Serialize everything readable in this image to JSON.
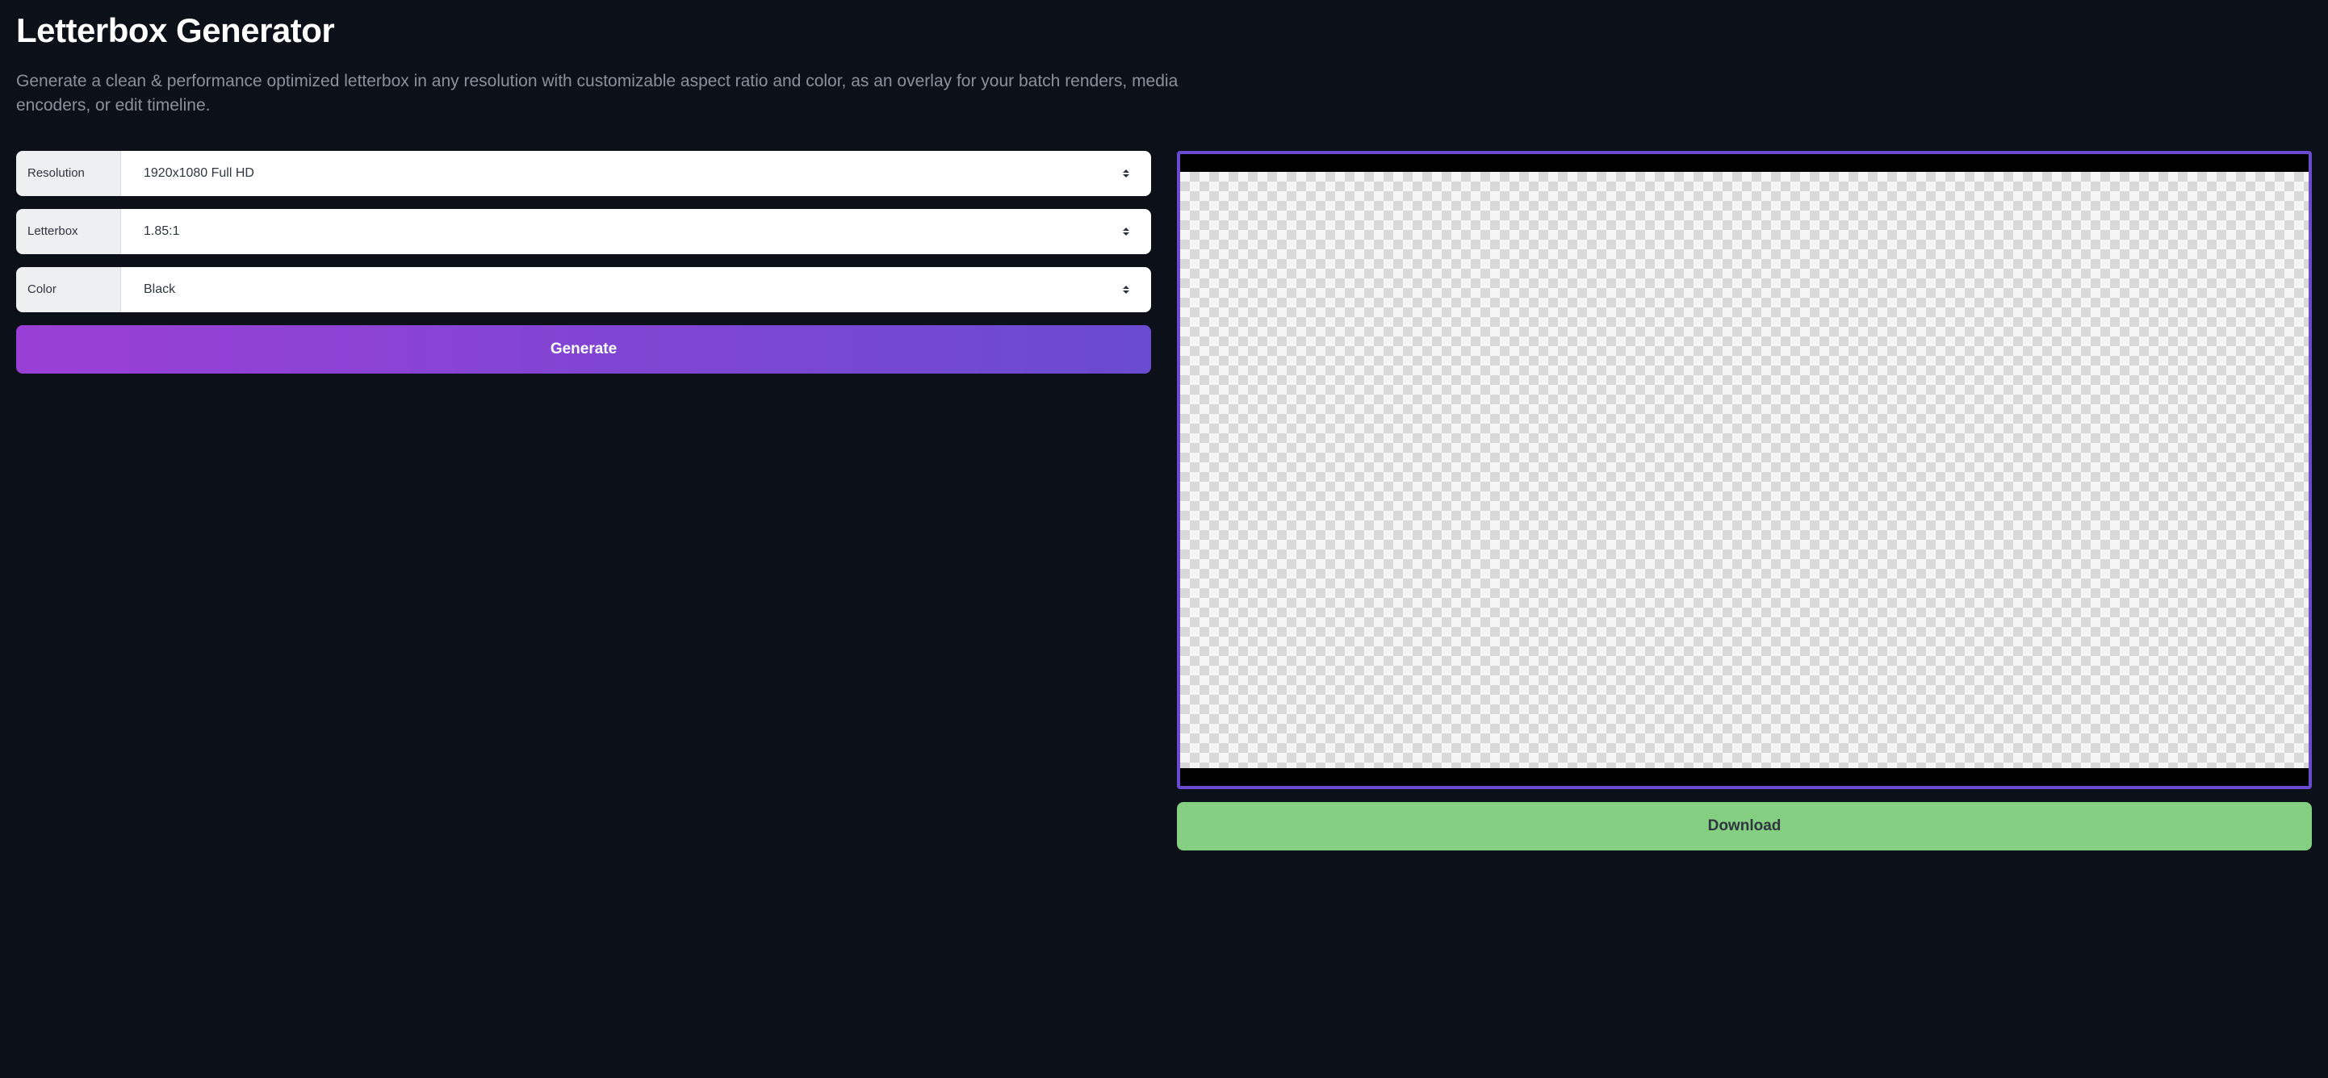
{
  "header": {
    "title": "Letterbox Generator",
    "subtitle": "Generate a clean & performance optimized letterbox in any resolution with customizable aspect ratio and color, as an overlay for your batch renders, media encoders, or edit timeline."
  },
  "form": {
    "resolution": {
      "label": "Resolution",
      "value": "1920x1080 Full HD"
    },
    "letterbox": {
      "label": "Letterbox",
      "value": "1.85:1"
    },
    "color": {
      "label": "Color",
      "value": "Black"
    }
  },
  "buttons": {
    "generate": "Generate",
    "download": "Download"
  },
  "colors": {
    "accent_purple_start": "#9a3fd6",
    "accent_purple_end": "#6a4bd0",
    "download_green": "#84cf82",
    "page_bg": "#0c1018"
  }
}
